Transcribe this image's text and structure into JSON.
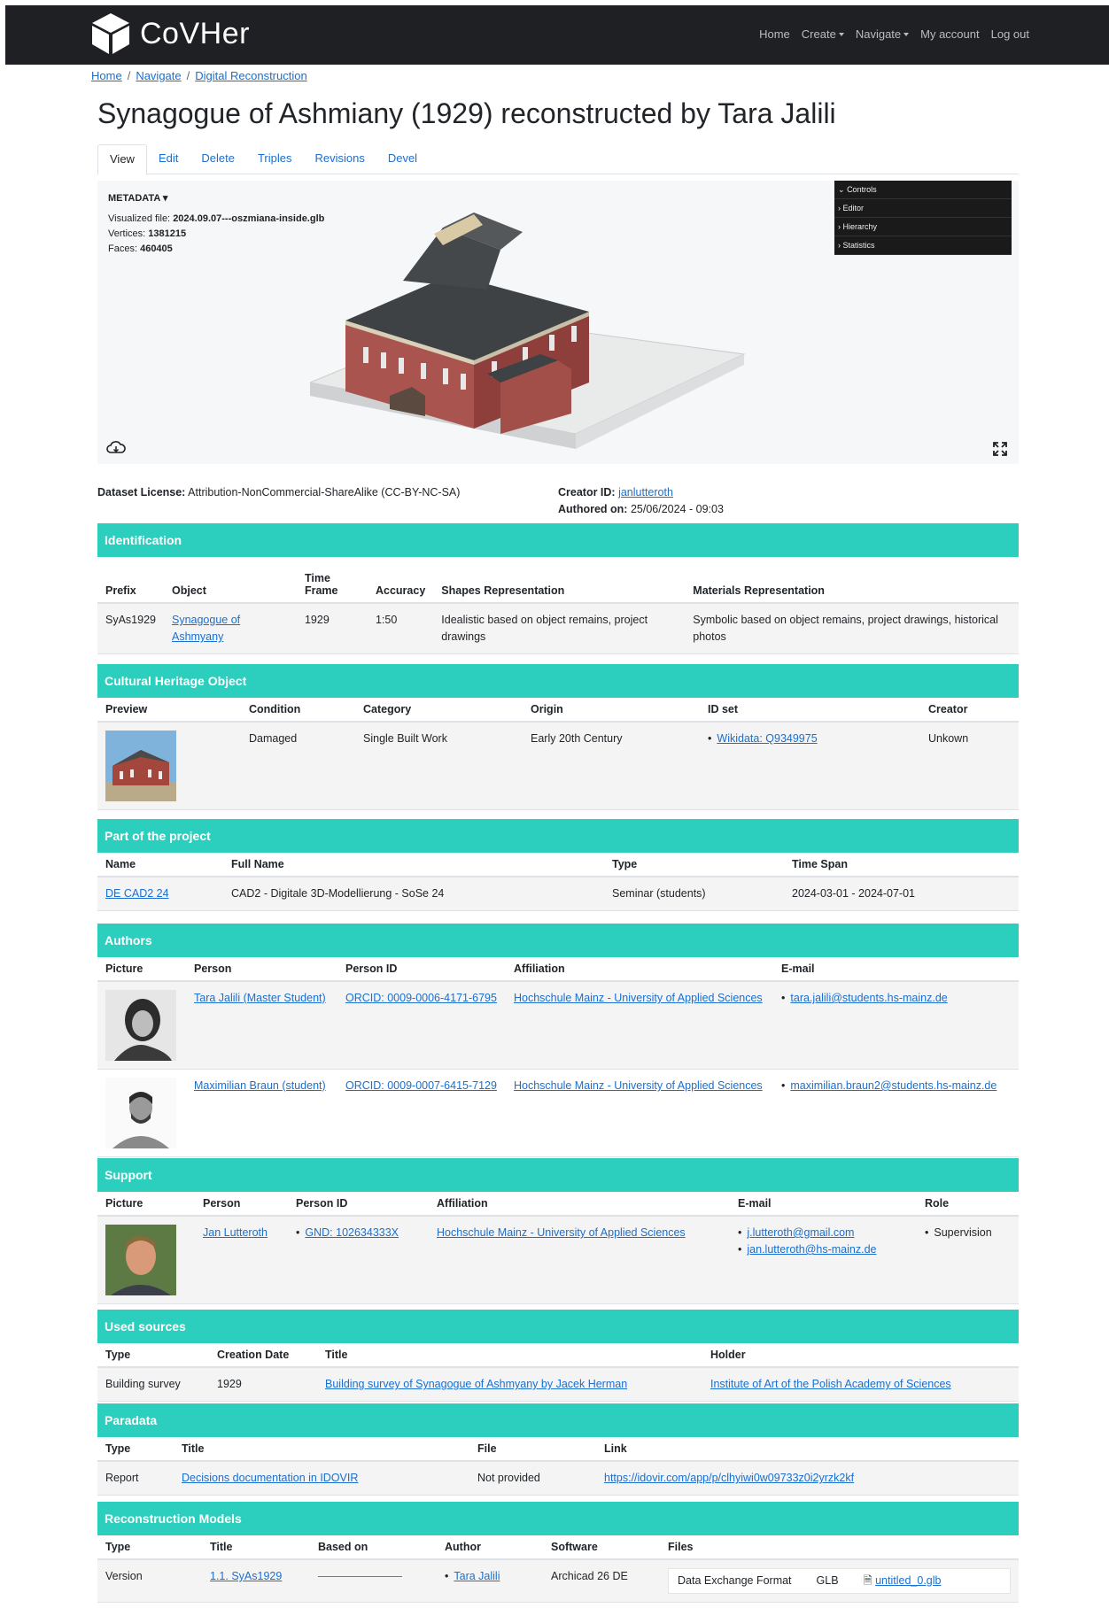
{
  "brand": {
    "name": "CoVHer"
  },
  "nav": {
    "home": "Home",
    "create": "Create",
    "navigate": "Navigate",
    "account": "My account",
    "logout": "Log out"
  },
  "breadcrumb": [
    "Home",
    "Navigate",
    "Digital Reconstruction"
  ],
  "page_title": "Synagogue of Ashmiany (1929) reconstructed by Tara Jalili",
  "tabs": [
    "View",
    "Edit",
    "Delete",
    "Triples",
    "Revisions",
    "Devel"
  ],
  "viewer": {
    "metadata_label": "METADATA",
    "file_label": "Visualized file:",
    "file": "2024.09.07---oszmiana-inside.glb",
    "vertices_label": "Vertices:",
    "vertices": "1381215",
    "faces_label": "Faces:",
    "faces": "460405",
    "controls": [
      "Controls",
      "Editor",
      "Hierarchy",
      "Statistics"
    ]
  },
  "license": {
    "label": "Dataset License:",
    "value": "Attribution-NonCommercial-ShareAlike (CC-BY-NC-SA)"
  },
  "creator": {
    "label": "Creator ID:",
    "value": "janlutteroth",
    "authored_label": "Authored on:",
    "authored": "25/06/2024 - 09:03"
  },
  "identification": {
    "title": "Identification",
    "headers": [
      "Prefix",
      "Object",
      "Time Frame",
      "Accuracy",
      "Shapes Representation",
      "Materials Representation"
    ],
    "row": {
      "prefix": "SyAs1929",
      "object": "Synagogue of Ashmyany",
      "time": "1929",
      "accuracy": "1:50",
      "shapes": "Idealistic based on object remains, project drawings",
      "materials": "Symbolic based on object remains, project drawings, historical photos"
    }
  },
  "heritage": {
    "title": "Cultural Heritage Object",
    "headers": [
      "Preview",
      "Condition",
      "Category",
      "Origin",
      "ID set",
      "Creator"
    ],
    "row": {
      "condition": "Damaged",
      "category": "Single Built Work",
      "origin": "Early 20th Century",
      "idset": "Wikidata: Q9349975",
      "creator": "Unkown"
    }
  },
  "project": {
    "title": "Part of the project",
    "headers": [
      "Name",
      "Full Name",
      "Type",
      "Time Span"
    ],
    "row": {
      "name": "DE CAD2 24",
      "full": "CAD2 - Digitale 3D-Modellierung - SoSe 24",
      "type": "Seminar (students)",
      "span": "2024-03-01 - 2024-07-01"
    }
  },
  "authors": {
    "title": "Authors",
    "headers": [
      "Picture",
      "Person",
      "Person ID",
      "Affiliation",
      "E-mail"
    ],
    "rows": [
      {
        "person": "Tara Jalili (Master Student)",
        "pid": "ORCID: 0009-0006-4171-6795",
        "aff": "Hochschule Mainz - University of Applied Sciences",
        "email": "tara.jalili@students.hs-mainz.de"
      },
      {
        "person": "Maximilian Braun (student)",
        "pid": "ORCID: 0009-0007-6415-7129",
        "aff": "Hochschule Mainz - University of Applied Sciences",
        "email": "maximilian.braun2@students.hs-mainz.de"
      }
    ]
  },
  "support": {
    "title": "Support",
    "headers": [
      "Picture",
      "Person",
      "Person ID",
      "Affiliation",
      "E-mail",
      "Role"
    ],
    "row": {
      "person": "Jan Lutteroth",
      "pid": "GND: 102634333X",
      "aff": "Hochschule Mainz - University of Applied Sciences",
      "email1": "j.lutteroth@gmail.com",
      "email2": "jan.lutteroth@hs-mainz.de",
      "role": "Supervision"
    }
  },
  "sources": {
    "title": "Used sources",
    "headers": [
      "Type",
      "Creation Date",
      "Title",
      "Holder"
    ],
    "row": {
      "type": "Building survey",
      "date": "1929",
      "title": "Building survey of Synagogue of Ashmyany by Jacek Herman",
      "holder": "Institute of Art of the Polish Academy of Sciences"
    }
  },
  "paradata": {
    "title": "Paradata",
    "headers": [
      "Type",
      "Title",
      "File",
      "Link"
    ],
    "row": {
      "type": "Report",
      "title": "Decisions documentation in IDOVIR",
      "file": "Not provided",
      "link": "https://idovir.com/app/p/clhyiwi0w09733z0i2yrzk2kf"
    }
  },
  "models": {
    "title": "Reconstruction Models",
    "headers": [
      "Type",
      "Title",
      "Based on",
      "Author",
      "Software",
      "Files"
    ],
    "row": {
      "type": "Version",
      "title": "1.1. SyAs1929",
      "author": "Tara Jalili",
      "software": "Archicad 26 DE",
      "file_format": "Data Exchange Format",
      "file_ext": "GLB",
      "file_name": "untitled_0.glb"
    }
  }
}
